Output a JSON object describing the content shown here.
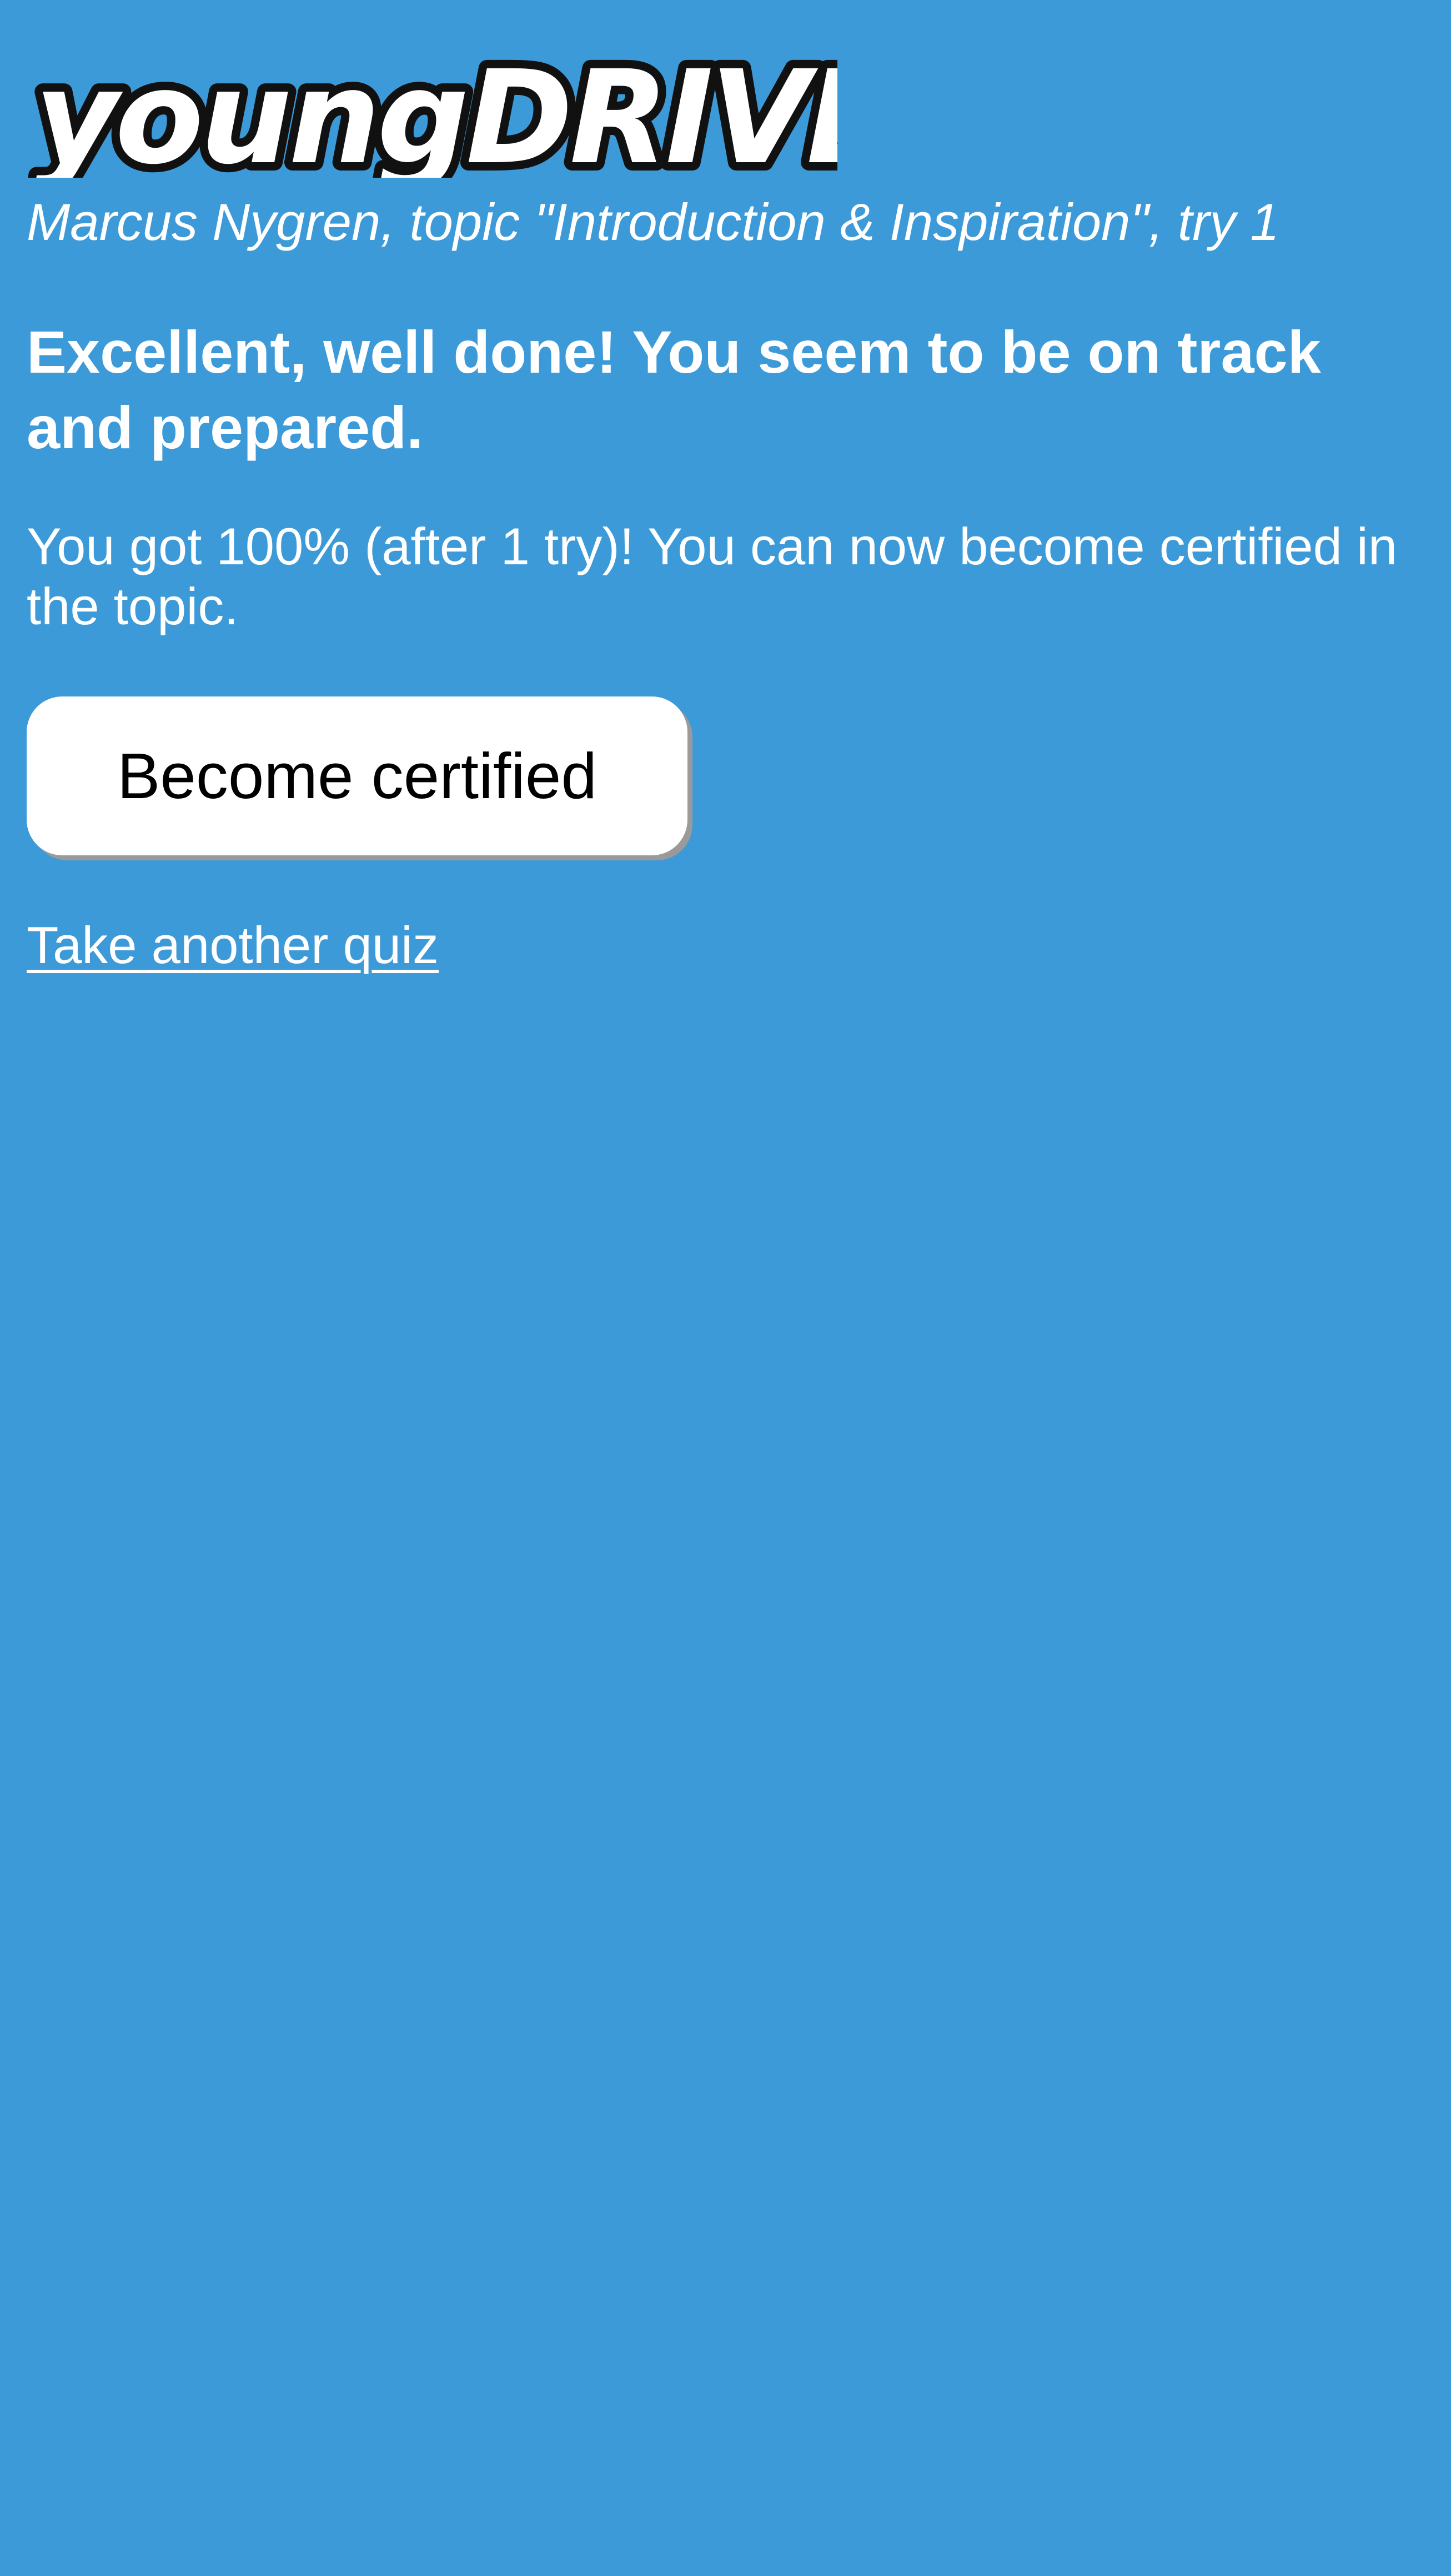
{
  "logo": {
    "text": "youngDRIVE!",
    "trademark": "™"
  },
  "quiz": {
    "subtitle": "Marcus Nygren, topic \"Introduction & Inspiration\", try 1",
    "headline": "Excellent, well done! You seem to be on track and prepared.",
    "message": "You got 100% (after 1 try)! You can now become certified in the topic."
  },
  "actions": {
    "certify_label": "Become certified",
    "another_quiz_label": "Take another quiz"
  },
  "colors": {
    "background": "#3d9ad8",
    "text": "#ffffff",
    "button_background": "#ffffff",
    "button_text": "#000000"
  }
}
